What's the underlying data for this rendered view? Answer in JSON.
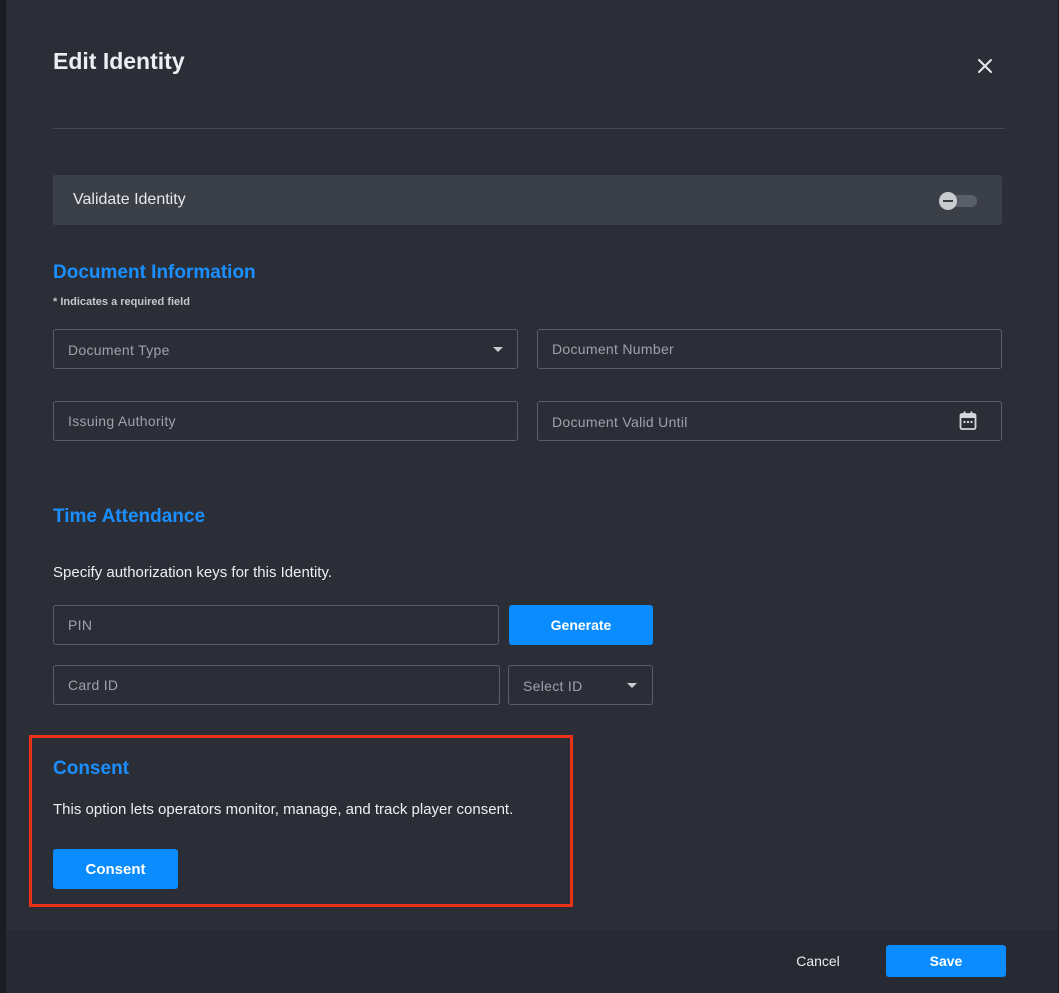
{
  "dialog": {
    "title": "Edit Identity",
    "close_icon": "close-icon"
  },
  "validate": {
    "label": "Validate Identity",
    "enabled": false
  },
  "document_info": {
    "title": "Document Information",
    "required_note": "* Indicates a required field",
    "document_type": {
      "placeholder": "Document Type"
    },
    "document_number": {
      "placeholder": "Document Number"
    },
    "issuing_authority": {
      "placeholder": "Issuing Authority"
    },
    "valid_until": {
      "placeholder": "Document Valid Until",
      "icon": "calendar-icon"
    }
  },
  "time_attendance": {
    "title": "Time Attendance",
    "description": "Specify authorization keys for this Identity.",
    "pin": {
      "placeholder": "PIN"
    },
    "generate_label": "Generate",
    "card_id": {
      "placeholder": "Card ID"
    },
    "select_id": {
      "placeholder": "Select ID"
    }
  },
  "consent": {
    "title": "Consent",
    "description": "This option lets operators monitor, manage, and track player consent.",
    "button_label": "Consent"
  },
  "footer": {
    "cancel_label": "Cancel",
    "save_label": "Save"
  },
  "colors": {
    "accent": "#0a8cff",
    "section_title": "#1a8fff",
    "highlight_border": "#e8321a",
    "background": "#2b2e37"
  }
}
